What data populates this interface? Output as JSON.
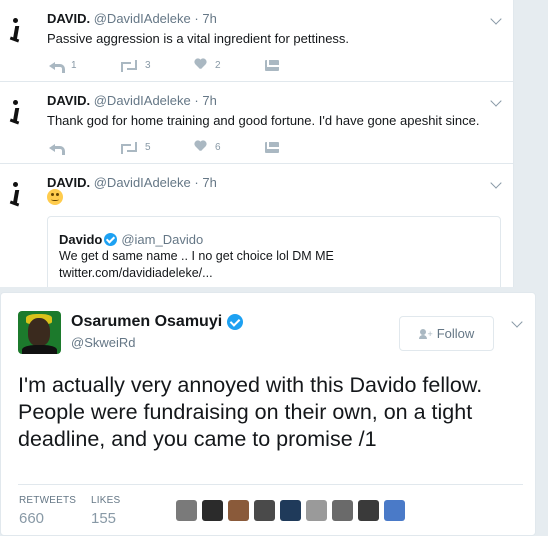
{
  "timeline": {
    "tweets": [
      {
        "name": "DAVID.",
        "handle": "@DavidIAdeleke",
        "time": "7h",
        "text": "Passive aggression is a vital ingredient for pettiness.",
        "replies": "1",
        "retweets": "3",
        "likes": "2"
      },
      {
        "name": "DAVID.",
        "handle": "@DavidIAdeleke",
        "time": "7h",
        "text": "Thank god for home training and good fortune. I'd have gone apeshit since.",
        "replies": "",
        "retweets": "5",
        "likes": "6"
      },
      {
        "name": "DAVID.",
        "handle": "@DavidIAdeleke",
        "time": "7h",
        "emoji": "upside-down-face",
        "quote": {
          "name": "Davido",
          "handle": "@iam_Davido",
          "line1": "We get d same name .. I no get choice lol DM ME",
          "line2": "twitter.com/davidiadeleke/..."
        }
      }
    ]
  },
  "embed": {
    "name": "Osarumen Osamuyi",
    "handle": "@SkweiRd",
    "follow_label": "Follow",
    "text": "I'm actually very annoyed with this Davido fellow. People were fundraising on their own, on a tight deadline, and you came to promise /1",
    "retweets_label": "RETWEETS",
    "retweets": "660",
    "likes_label": "LIKES",
    "likes": "155",
    "liker_colors": [
      "#7a7a7a",
      "#2b2b2b",
      "#8a5a3a",
      "#4a4a4a",
      "#1f3a5a",
      "#9a9a9a",
      "#6a6a6a",
      "#3a3a3a",
      "#4a7ac8"
    ]
  },
  "colors": {
    "verified": "#1da1f2",
    "muted": "#657786",
    "icon": "#aab8c2"
  }
}
